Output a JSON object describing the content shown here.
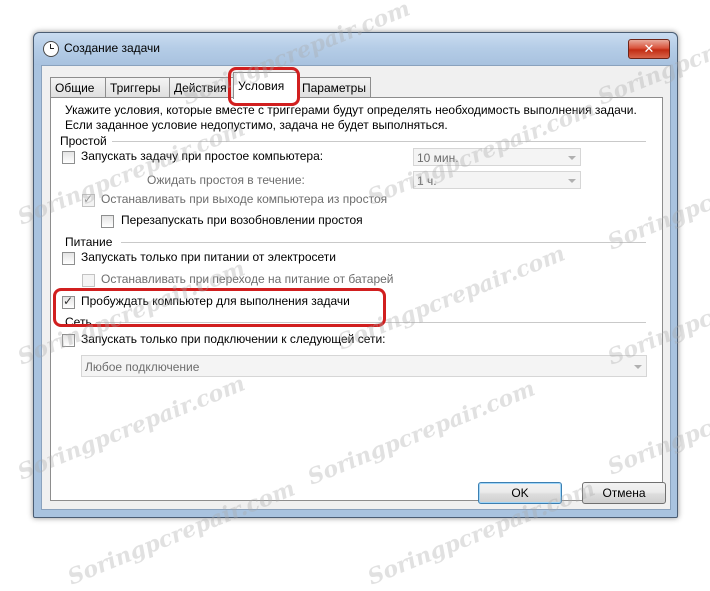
{
  "window": {
    "title": "Создание задачи",
    "close_label": "✕"
  },
  "tabs": [
    {
      "label": "Общие",
      "active": false
    },
    {
      "label": "Триггеры",
      "active": false
    },
    {
      "label": "Действия",
      "active": false
    },
    {
      "label": "Условия",
      "active": true
    },
    {
      "label": "Параметры",
      "active": false
    }
  ],
  "conditions": {
    "description_line1": "Укажите условия, которые вместе с триггерами будут определять необходимость выполнения задачи.",
    "description_line2": "Если заданное условие недопустимо, задача не будет выполняться.",
    "idle": {
      "section_label": "Простой",
      "start_on_idle_label": "Запускать задачу при простое компьютера:",
      "start_on_idle_checked": false,
      "idle_duration_value": "10 мин.",
      "wait_label": "Ожидать простоя в течение:",
      "wait_value": "1 ч.",
      "stop_on_resume_label": "Останавливать при выходе компьютера из простоя",
      "stop_on_resume_checked": true,
      "restart_label": "Перезапускать при возобновлении простоя",
      "restart_checked": false
    },
    "power": {
      "section_label": "Питание",
      "ac_only_label": "Запускать только при питании от электросети",
      "ac_only_checked": false,
      "stop_on_battery_label": "Останавливать при переходе на питание от батарей",
      "stop_on_battery_checked": false,
      "wake_label": "Пробуждать компьютер для выполнения задачи",
      "wake_checked": true
    },
    "network": {
      "section_label": "Сеть",
      "network_only_label": "Запускать только при подключении к следующей сети:",
      "network_only_checked": false,
      "network_value": "Любое подключение"
    }
  },
  "buttons": {
    "ok_label": "OK",
    "cancel_label": "Отмена"
  },
  "watermark": "Soringpcrepair.com",
  "colors": {
    "highlight": "#d11f1f",
    "window_frame": "#a9c3df"
  }
}
